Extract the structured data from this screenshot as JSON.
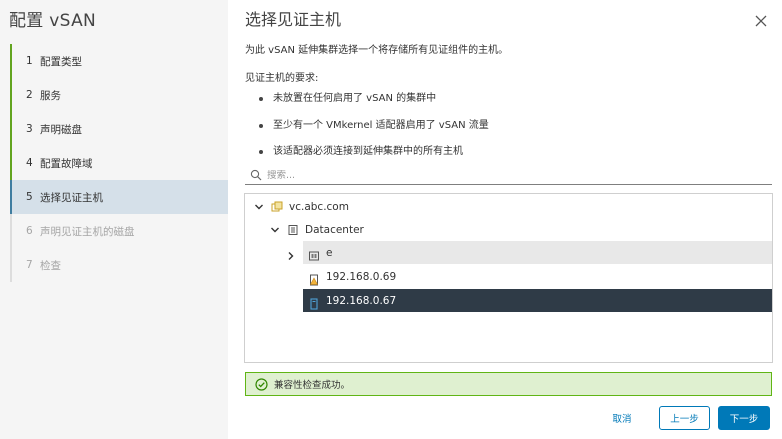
{
  "wizard": {
    "title": "配置 vSAN",
    "steps": [
      {
        "num": "1",
        "label": "配置类型",
        "state": "done"
      },
      {
        "num": "2",
        "label": "服务",
        "state": "done"
      },
      {
        "num": "3",
        "label": "声明磁盘",
        "state": "done"
      },
      {
        "num": "4",
        "label": "配置故障域",
        "state": "done"
      },
      {
        "num": "5",
        "label": "选择见证主机",
        "state": "active"
      },
      {
        "num": "6",
        "label": "声明见证主机的磁盘",
        "state": "disabled"
      },
      {
        "num": "7",
        "label": "检查",
        "state": "disabled"
      }
    ]
  },
  "page": {
    "title": "选择见证主机",
    "description": "为此 vSAN 延伸集群选择一个将存储所有见证组件的主机。",
    "requirements_heading": "见证主机的要求:",
    "requirements": [
      "未放置在任何启用了 vSAN 的集群中",
      "至少有一个 VMkernel 适配器启用了 vSAN 流量",
      "该适配器必须连接到延伸集群中的所有主机"
    ]
  },
  "search": {
    "placeholder": "搜索...",
    "value": ""
  },
  "tree": {
    "vcenter": "vc.abc.com",
    "datacenter": "Datacenter",
    "cluster": "e",
    "hosts": [
      {
        "name": "192.168.0.69",
        "selected": false
      },
      {
        "name": "192.168.0.67",
        "selected": true
      }
    ]
  },
  "alert": {
    "status": "success",
    "text": "兼容性检查成功。"
  },
  "buttons": {
    "cancel": "取消",
    "back": "上一步",
    "next": "下一步"
  },
  "colors": {
    "accent": "#0079b8",
    "done_step": "#62a420",
    "selected_row": "#2f3b47",
    "success_bg": "#dff0d0"
  }
}
